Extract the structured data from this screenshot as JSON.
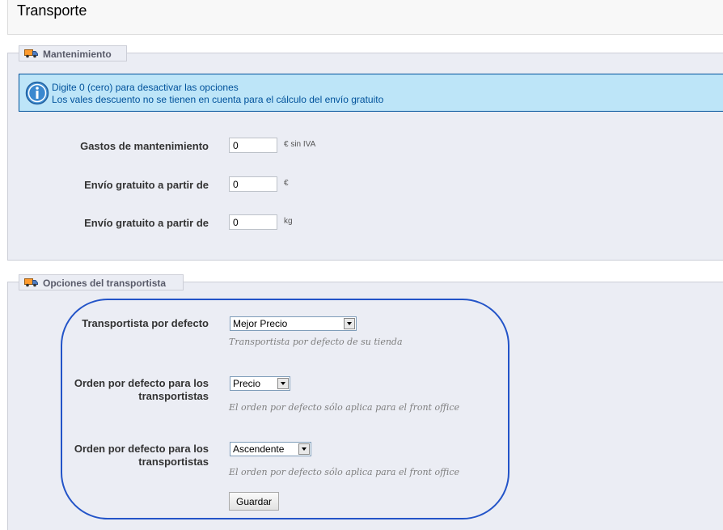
{
  "page": {
    "title": "Transporte"
  },
  "maintenance": {
    "legend": "Mantenimiento",
    "info_line1": "Digite 0 (cero) para desactivar las opciones",
    "info_line2": "Los vales descuento no se tienen en cuenta para el cálculo del envío gratuito",
    "fields": [
      {
        "label": "Gastos de mantenimiento",
        "value": "0",
        "unit": "€ sin IVA"
      },
      {
        "label": "Envío gratuito a partir de",
        "value": "0",
        "unit": "€"
      },
      {
        "label": "Envío gratuito a partir de",
        "value": "0",
        "unit": "kg"
      }
    ]
  },
  "carrier": {
    "legend": "Opciones del transportista",
    "default_carrier": {
      "label": "Transportista por defecto",
      "selected": "Mejor Precio",
      "hint": "Transportista por defecto de su tienda"
    },
    "sort_by": {
      "label_line1": "Orden por defecto para los",
      "label_line2": "transportistas",
      "selected": "Precio",
      "hint": "El orden por defecto sólo aplica para el front office"
    },
    "sort_way": {
      "label_line1": "Orden por defecto para los",
      "label_line2": "transportistas",
      "selected": "Ascendente",
      "hint": "El orden por defecto sólo aplica para el front office"
    },
    "save_label": "Guardar"
  },
  "icons": {
    "legend_icon": "truck-icon",
    "info_icon": "info-icon"
  },
  "colors": {
    "info_bg": "#bde5f8",
    "info_text": "#00529b",
    "highlight": "#2354c8"
  }
}
